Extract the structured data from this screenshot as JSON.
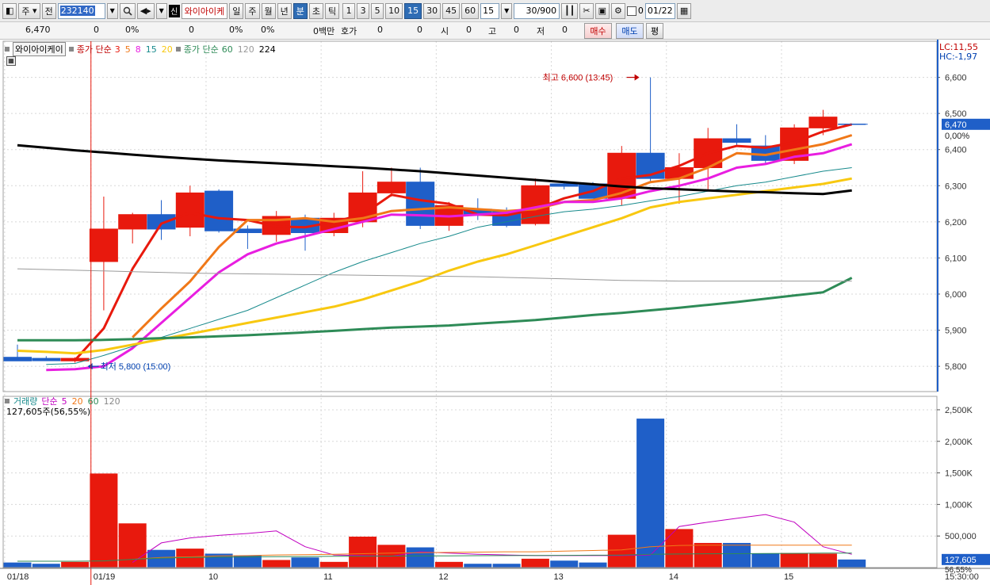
{
  "toolbar": {
    "period_type": "주",
    "view_label": "전",
    "code": "232140",
    "stock_badge": "신",
    "stock_name": "와이아이케",
    "period_buttons": [
      "일",
      "주",
      "월",
      "년",
      "분",
      "초",
      "틱"
    ],
    "active_period": "분",
    "interval_buttons": [
      "1",
      "3",
      "5",
      "10",
      "15",
      "30",
      "45",
      "60"
    ],
    "active_interval": "15",
    "interval_value": "15",
    "count": "30/900",
    "checkbox_label": "0",
    "date": "01/22"
  },
  "quote": {
    "price": "6,470",
    "change": "0",
    "change_pct": "0%",
    "volume": "0",
    "volume_pct": "0%",
    "amount": "0백만",
    "hoga_label": "호가",
    "hoga1": "0",
    "hoga2": "0",
    "open_label": "시",
    "open": "0",
    "high_label": "고",
    "high": "0",
    "low_label": "저",
    "low": "0",
    "buy_label": "매수",
    "sell_label": "매도",
    "balance_label": "평"
  },
  "price_legend": {
    "name": "와이아이케이",
    "ma_label": "종가 단순",
    "ma_periods": [
      "3",
      "5",
      "8",
      "15",
      "20"
    ],
    "ma2_label": "종가 단순",
    "ma2_periods": [
      "60",
      "120",
      "224"
    ],
    "lc": "LC:11,55",
    "hc": "HC:-1,97"
  },
  "volume_legend": {
    "label": "거래량",
    "ma_label": "단순",
    "periods": [
      "5",
      "20",
      "60",
      "120"
    ],
    "current": "127,605주(56,55%)"
  },
  "colors": {
    "up": "#e8190d",
    "down": "#1f5fc8",
    "ma3": "#e8190d",
    "ma5": "#f07818",
    "ma8": "#e81ee0",
    "ma15": "#178a8c",
    "ma20": "#f8c810",
    "ma60": "#2e8b57",
    "ma120": "#9a9a9a",
    "ma224": "#000000"
  },
  "chart_data": {
    "type": "candlestick",
    "y_ticks": [
      5800,
      5900,
      6000,
      6100,
      6200,
      6300,
      6400,
      6500,
      6600
    ],
    "y_tick_labels": [
      "5,800",
      "5,900",
      "6,000",
      "6,100",
      "6,200",
      "6,300",
      "6,400",
      "6,500",
      "6,600"
    ],
    "ylim": [
      5730,
      6700
    ],
    "current_price_label": "6,470",
    "current_pct_label": "0,00%",
    "current_price": 6470,
    "high_annotation": "최고 6,600 (13:45)",
    "high_value": 6600,
    "low_annotation": "최저 5,800 (15:00)",
    "low_value": 5800,
    "x_labels": [
      {
        "index": 0,
        "label": "01/18"
      },
      {
        "index": 3,
        "label": "01/19"
      },
      {
        "index": 7,
        "label": "10"
      },
      {
        "index": 11,
        "label": "11"
      },
      {
        "index": 15,
        "label": "12"
      },
      {
        "index": 19,
        "label": "13"
      },
      {
        "index": 23,
        "label": "14"
      },
      {
        "index": 27,
        "label": "15"
      }
    ],
    "time_label": "15:30:00",
    "candles": [
      {
        "o": 5825,
        "h": 5860,
        "l": 5815,
        "c": 5815
      },
      {
        "o": 5822,
        "h": 5828,
        "l": 5818,
        "c": 5818
      },
      {
        "o": 5815,
        "h": 5825,
        "l": 5810,
        "c": 5822
      },
      {
        "o": 6090,
        "h": 6270,
        "l": 5955,
        "c": 6180
      },
      {
        "o": 6180,
        "h": 6225,
        "l": 6140,
        "c": 6220
      },
      {
        "o": 6220,
        "h": 6260,
        "l": 6150,
        "c": 6180
      },
      {
        "o": 6185,
        "h": 6300,
        "l": 6160,
        "c": 6280
      },
      {
        "o": 6285,
        "h": 6290,
        "l": 6170,
        "c": 6175
      },
      {
        "o": 6180,
        "h": 6190,
        "l": 6125,
        "c": 6170
      },
      {
        "o": 6165,
        "h": 6230,
        "l": 6145,
        "c": 6215
      },
      {
        "o": 6210,
        "h": 6220,
        "l": 6120,
        "c": 6170
      },
      {
        "o": 6170,
        "h": 6225,
        "l": 6160,
        "c": 6210
      },
      {
        "o": 6200,
        "h": 6340,
        "l": 6185,
        "c": 6280
      },
      {
        "o": 6280,
        "h": 6350,
        "l": 6270,
        "c": 6310
      },
      {
        "o": 6310,
        "h": 6350,
        "l": 6180,
        "c": 6190
      },
      {
        "o": 6190,
        "h": 6255,
        "l": 6175,
        "c": 6245
      },
      {
        "o": 6235,
        "h": 6265,
        "l": 6205,
        "c": 6220
      },
      {
        "o": 6230,
        "h": 6240,
        "l": 6185,
        "c": 6190
      },
      {
        "o": 6195,
        "h": 6320,
        "l": 6190,
        "c": 6300
      },
      {
        "o": 6305,
        "h": 6310,
        "l": 6290,
        "c": 6300
      },
      {
        "o": 6305,
        "h": 6310,
        "l": 6265,
        "c": 6265
      },
      {
        "o": 6265,
        "h": 6410,
        "l": 6245,
        "c": 6390
      },
      {
        "o": 6390,
        "h": 6600,
        "l": 6310,
        "c": 6320
      },
      {
        "o": 6320,
        "h": 6390,
        "l": 6250,
        "c": 6350
      },
      {
        "o": 6350,
        "h": 6460,
        "l": 6290,
        "c": 6430
      },
      {
        "o": 6430,
        "h": 6470,
        "l": 6410,
        "c": 6420
      },
      {
        "o": 6410,
        "h": 6440,
        "l": 6360,
        "c": 6370
      },
      {
        "o": 6370,
        "h": 6470,
        "l": 6360,
        "c": 6460
      },
      {
        "o": 6460,
        "h": 6510,
        "l": 6440,
        "c": 6490
      },
      {
        "o": 6470,
        "h": 6470,
        "l": 6470,
        "c": 6470
      }
    ],
    "ma_series": [
      {
        "key": "ma3",
        "values": [
          null,
          null,
          5817,
          5905,
          6070,
          6195,
          6225,
          6210,
          6205,
          6187,
          6185,
          6200,
          6220,
          6275,
          6260,
          6250,
          6220,
          6218,
          6235,
          6265,
          6285,
          6320,
          6330,
          6355,
          6390,
          6410,
          6405,
          6420,
          6450,
          6470
        ],
        "width": 3
      },
      {
        "key": "ma5",
        "values": [
          null,
          null,
          null,
          null,
          5880,
          5960,
          6035,
          6130,
          6205,
          6205,
          6210,
          6200,
          6210,
          6230,
          6235,
          6240,
          6235,
          6230,
          6235,
          6255,
          6260,
          6280,
          6310,
          6320,
          6350,
          6390,
          6385,
          6400,
          6415,
          6440
        ],
        "width": 3
      },
      {
        "key": "ma8",
        "values": [
          null,
          5790,
          5792,
          5800,
          5850,
          5920,
          5990,
          6060,
          6110,
          6140,
          6160,
          6180,
          6200,
          6220,
          6218,
          6215,
          6220,
          6225,
          6240,
          6255,
          6255,
          6265,
          6285,
          6300,
          6320,
          6350,
          6360,
          6380,
          6390,
          6415
        ],
        "width": 3
      },
      {
        "key": "ma15",
        "values": [
          null,
          5805,
          5808,
          5830,
          5855,
          5880,
          5905,
          5930,
          5955,
          5990,
          6025,
          6060,
          6090,
          6115,
          6140,
          6160,
          6185,
          6200,
          6215,
          6228,
          6235,
          6245,
          6258,
          6270,
          6285,
          6300,
          6310,
          6325,
          6340,
          6350
        ],
        "width": 1
      },
      {
        "key": "ma20",
        "values": [
          5843,
          5840,
          5836,
          5845,
          5860,
          5875,
          5890,
          5905,
          5920,
          5935,
          5950,
          5965,
          5985,
          6010,
          6035,
          6065,
          6090,
          6110,
          6135,
          6160,
          6185,
          6210,
          6240,
          6255,
          6265,
          6275,
          6285,
          6295,
          6305,
          6320
        ],
        "width": 3
      },
      {
        "key": "ma60",
        "values": [
          5872,
          5872,
          5872,
          5873,
          5875,
          5878,
          5880,
          5883,
          5886,
          5890,
          5894,
          5898,
          5903,
          5907,
          5910,
          5913,
          5918,
          5923,
          5928,
          5935,
          5942,
          5948,
          5955,
          5962,
          5970,
          5978,
          5987,
          5996,
          6005,
          6045
        ],
        "width": 3
      },
      {
        "key": "ma120",
        "values": [
          6070,
          6068,
          6066,
          6064,
          6062,
          6060,
          6058,
          6057,
          6056,
          6055,
          6054,
          6053,
          6052,
          6051,
          6050,
          6049,
          6048,
          6046,
          6044,
          6042,
          6040,
          6038,
          6037,
          6036,
          6036,
          6036,
          6036,
          6036,
          6036,
          6036
        ],
        "width": 1
      },
      {
        "key": "ma224",
        "values": [
          6412,
          6405,
          6398,
          6392,
          6386,
          6380,
          6375,
          6370,
          6366,
          6362,
          6358,
          6354,
          6350,
          6345,
          6340,
          6334,
          6328,
          6322,
          6316,
          6310,
          6304,
          6298,
          6293,
          6290,
          6287,
          6284,
          6282,
          6279,
          6277,
          6287
        ],
        "width": 3
      }
    ],
    "volume": {
      "y_ticks": [
        500000,
        1000000,
        1500000,
        2000000,
        2500000
      ],
      "y_tick_labels": [
        "500,000",
        "1,000K",
        "1,500K",
        "2,000K",
        "2,500K"
      ],
      "ylim": [
        0,
        2650000
      ],
      "current_label": "127,605",
      "current_pct_label": "56,55%",
      "bars": [
        80000,
        60000,
        90000,
        1490000,
        700000,
        280000,
        300000,
        220000,
        190000,
        120000,
        160000,
        90000,
        490000,
        360000,
        320000,
        90000,
        60000,
        60000,
        140000,
        110000,
        80000,
        520000,
        2360000,
        610000,
        390000,
        390000,
        220000,
        230000,
        220000,
        127605
      ],
      "ma5": [
        null,
        null,
        null,
        null,
        80000,
        390000,
        470000,
        510000,
        540000,
        580000,
        330000,
        200000,
        190000,
        180000,
        250000,
        230000,
        210000,
        200000,
        190000,
        190000,
        190000,
        190000,
        200000,
        650000,
        720000,
        780000,
        840000,
        720000,
        330000,
        210000
      ],
      "ma20": [
        null,
        null,
        null,
        null,
        130000,
        160000,
        170000,
        185000,
        190000,
        200000,
        205000,
        210000,
        220000,
        230000,
        235000,
        240000,
        245000,
        250000,
        250000,
        260000,
        270000,
        280000,
        330000,
        350000,
        355000,
        355000,
        355000,
        355000,
        355000,
        355000
      ],
      "ma60": [
        100000,
        100000,
        100000,
        105000,
        130000,
        150000,
        160000,
        165000,
        170000,
        172000,
        175000,
        178000,
        180000,
        182000,
        184000,
        186000,
        188000,
        190000,
        192000,
        194000,
        196000,
        198000,
        210000,
        215000,
        218000,
        220000,
        222000,
        225000,
        228000,
        230000
      ]
    }
  }
}
